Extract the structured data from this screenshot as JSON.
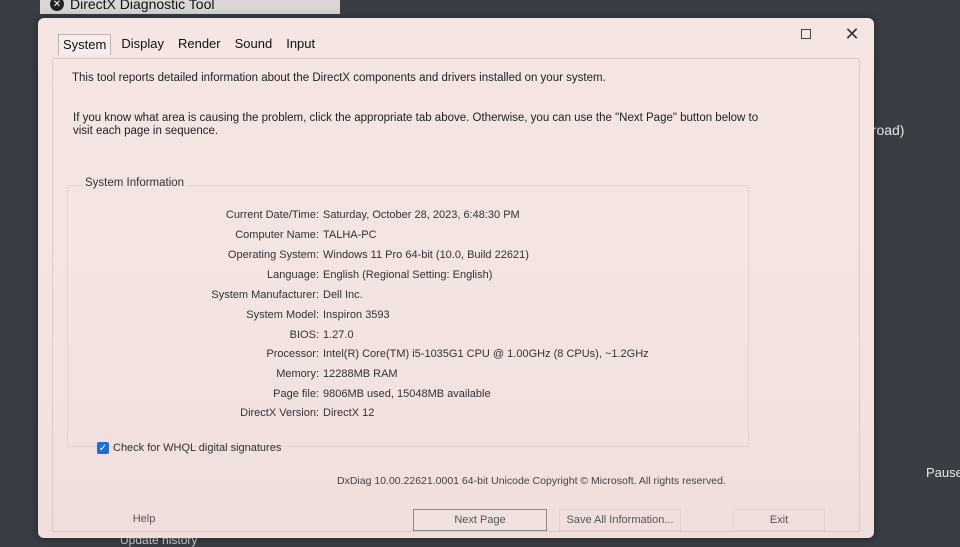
{
  "window": {
    "title": "DirectX Diagnostic Tool",
    "close_glyph": "✕"
  },
  "tabs": [
    {
      "label": "System"
    },
    {
      "label": "Display"
    },
    {
      "label": "Render"
    },
    {
      "label": "Sound"
    },
    {
      "label": "Input"
    }
  ],
  "intro": "This tool reports detailed information about the DirectX components and drivers installed on your system.",
  "help_text": "If you know what area is causing the problem, click the appropriate tab above.  Otherwise, you can use the \"Next Page\" button below to visit each page in sequence.",
  "system_info": {
    "group_label": "System Information",
    "rows": [
      {
        "label": "Current Date/Time:",
        "value": "Saturday, October 28, 2023, 6:48:30 PM"
      },
      {
        "label": "Computer Name:",
        "value": "TALHA-PC"
      },
      {
        "label": "Operating System:",
        "value": "Windows 11 Pro 64-bit (10.0, Build 22621)"
      },
      {
        "label": "Language:",
        "value": "English (Regional Setting: English)"
      },
      {
        "label": "System Manufacturer:",
        "value": "Dell Inc."
      },
      {
        "label": "System Model:",
        "value": "Inspiron 3593"
      },
      {
        "label": "BIOS:",
        "value": "1.27.0"
      },
      {
        "label": "Processor:",
        "value": "Intel(R) Core(TM) i5-1035G1 CPU @ 1.00GHz (8 CPUs), ~1.2GHz"
      },
      {
        "label": "Memory:",
        "value": "12288MB RAM"
      },
      {
        "label": "Page file:",
        "value": "9806MB used, 15048MB available"
      },
      {
        "label": "DirectX Version:",
        "value": "DirectX 12"
      }
    ]
  },
  "whql": {
    "label": "Check for WHQL digital signatures",
    "checked": true
  },
  "copyright": "DxDiag 10.00.22621.0001 64-bit Unicode  Copyright © Microsoft. All rights reserved.",
  "buttons": {
    "help": "Help",
    "next_page": "Next Page",
    "save_all": "Save All Information...",
    "exit": "Exit"
  },
  "background": {
    "right_text": "broad)",
    "pause": "Pause",
    "bottom_text": "Update history"
  },
  "colors": {
    "checkbox": "#1f6fd1",
    "dialog_bg": "#f4e4e2"
  }
}
